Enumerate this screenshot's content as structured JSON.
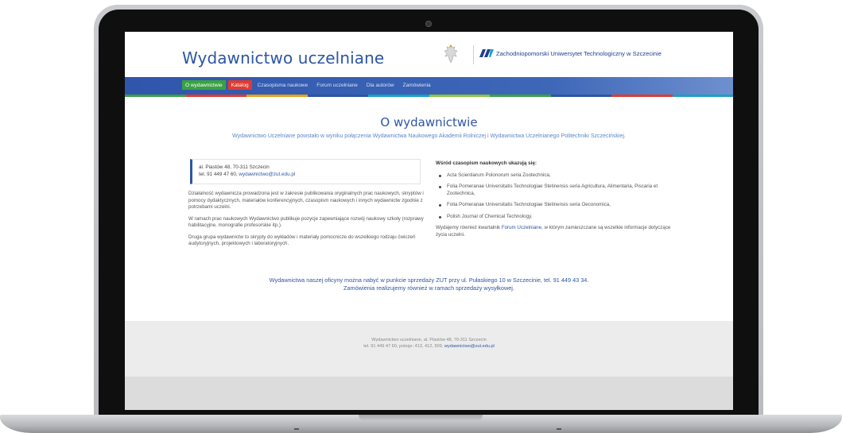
{
  "site": {
    "title": "Wydawnictwo uczelniane",
    "university_name": "Zachodniopomorski Uniwersytet Technologiczny w Szczecinie"
  },
  "nav": {
    "items": [
      {
        "label": "O wydawnictwie"
      },
      {
        "label": "Katalog"
      },
      {
        "label": "Czasopisma naukowe"
      },
      {
        "label": "Forum uczelniane"
      },
      {
        "label": "Dla autorów"
      },
      {
        "label": "Zamówienia"
      }
    ]
  },
  "colors": {
    "brand_blue": "#2c56a3",
    "active_nav": "#3aa143",
    "catalog_nav": "#e03a2f",
    "strip": [
      "#3aa143",
      "#e03a2f",
      "#e6a21a",
      "#2c56a3",
      "#19a0c4",
      "#8bc43f",
      "#3aa143",
      "#2c56a3",
      "#e03a2f",
      "#19a0c4"
    ]
  },
  "main": {
    "title": "O wydawnictwie",
    "lead": "Wydawnictwo Uczelniane powstało w wyniku połączenia Wydawnictwa Naukowego Akademii Rolniczej i Wydawnictwa Uczelnianego Politechniki Szczecińskiej.",
    "address": {
      "line1": "al. Piastów 48, 70-311 Szczecin",
      "phone": "tel. 91 449 47 60,",
      "email": "wydawnictwo@zut.edu.pl"
    },
    "paragraphs": [
      "Działalność wydawnicza prowadzona jest w zakresie publikowania oryginalnych prac naukowych, skryptów i pomocy dydaktycznych, materiałów konferencyjnych, czasopism naukowych i innych wydawnictw zgodnie z potrzebami uczelni.",
      "W ramach prac naukowych Wydawnictwo publikuje pozycje zapewniające rozwój naukowy szkoły (rozprawy habilitacyjne, monografie profesorskie itp.).",
      "Druga grupa wydawnictw to skrypty do wykładów i materiały pomocnicze do wszelkiego rodzaju ćwiczeń audytoryjnych, projektowych i laboratoryjnych."
    ],
    "journals_heading": "Wśród czasopism naukowych ukazują się:",
    "journals": [
      "Acta Scientiarum Polonorum seria Zootechnica,",
      "Folia Pomeranae Universitatis Technologiae Stetinensis seria Agricultura, Alimentaria, Piscaria et Zootechnica,",
      "Folia Pomeranae Universitatis Technologiae Stetinensis seria Oeconomica,",
      "Polish Journal of Chemical Technology."
    ],
    "forum_text_before": "Wydajemy również kwartalnik",
    "forum_link": "Forum Uczelniane",
    "forum_text_after": ", w którym zamieszczane są wszelkie informacje dotyczące życia uczelni.",
    "sales_line1": "Wydawnictwa naszej oficyny można nabyć w punkcie sprzedaży ZUT przy ul. Pułaskiego 10 w Szczecinie, tel. 91 449 43 34.",
    "sales_line2": "Zamówienia realizujemy również w ramach sprzedaży wysyłkowej."
  },
  "footer": {
    "line1": "Wydawnictwo uczelniane, al. Piastów 48, 70-311 Szczecin",
    "line2": "tel. 91 449 47 60, pokoje: 413, 412, 509,",
    "email": "wydawnictwo@zut.edu.pl"
  }
}
